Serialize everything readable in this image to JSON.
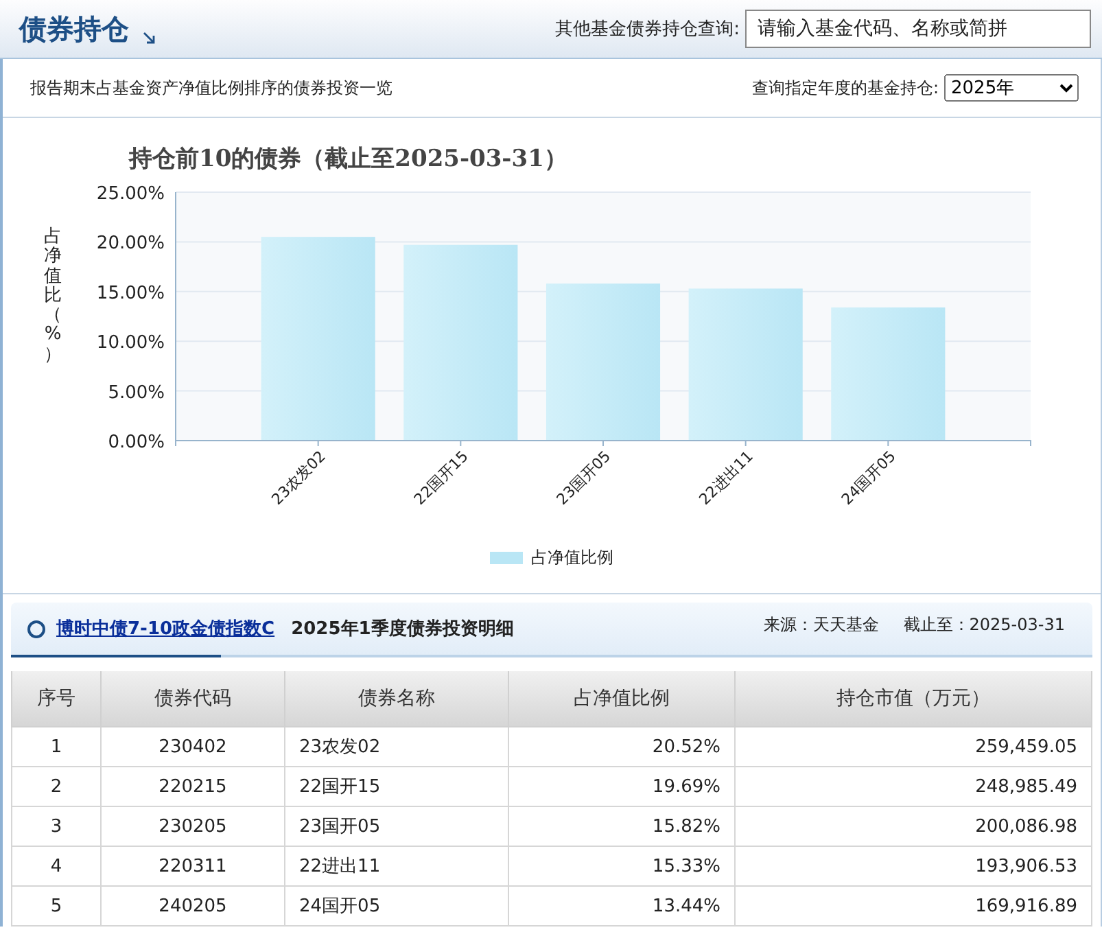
{
  "header": {
    "title": "债券持仓",
    "search_label": "其他基金债券持仓查询:",
    "search_placeholder": "请输入基金代码、名称或简拼"
  },
  "subheader": {
    "description": "报告期末占基金资产净值比例排序的债券投资一览",
    "year_label": "查询指定年度的基金持仓:",
    "year_value": "2025年"
  },
  "chart": {
    "chart_data": {
      "type": "bar",
      "title": "持仓前10的债券（截止至2025-03-31）",
      "ylabel": "占净值比（%）",
      "categories": [
        "23农发02",
        "22国开15",
        "23国开05",
        "22进出11",
        "24国开05"
      ],
      "series": [
        {
          "name": "占净值比例",
          "color": "#b9e6f5",
          "values": [
            20.5,
            19.7,
            15.8,
            15.3,
            13.4
          ]
        }
      ],
      "grid": true,
      "ylim": [
        0,
        25
      ],
      "yticks": [
        {
          "value": 0,
          "label": "0.00%"
        },
        {
          "value": 5,
          "label": "5.00%"
        },
        {
          "value": 10,
          "label": "10.00%"
        },
        {
          "value": 15,
          "label": "15.00%"
        },
        {
          "value": 20,
          "label": "20.00%"
        },
        {
          "value": 25,
          "label": "25.00%"
        }
      ]
    }
  },
  "detail": {
    "fund_link": "博时中债7-10政金债指数C",
    "title": "2025年1季度债券投资明细",
    "source": "来源：天天基金",
    "as_of": "截止至：2025-03-31",
    "table": {
      "columns": [
        "序号",
        "债券代码",
        "债券名称",
        "占净值比例",
        "持仓市值（万元）"
      ],
      "rows": [
        [
          "1",
          "230402",
          "23农发02",
          "20.52%",
          "259,459.05"
        ],
        [
          "2",
          "220215",
          "22国开15",
          "19.69%",
          "248,985.49"
        ],
        [
          "3",
          "230205",
          "23国开05",
          "15.82%",
          "200,086.98"
        ],
        [
          "4",
          "220311",
          "22进出11",
          "15.33%",
          "193,906.53"
        ],
        [
          "5",
          "240205",
          "24国开05",
          "13.44%",
          "169,916.89"
        ]
      ]
    }
  }
}
